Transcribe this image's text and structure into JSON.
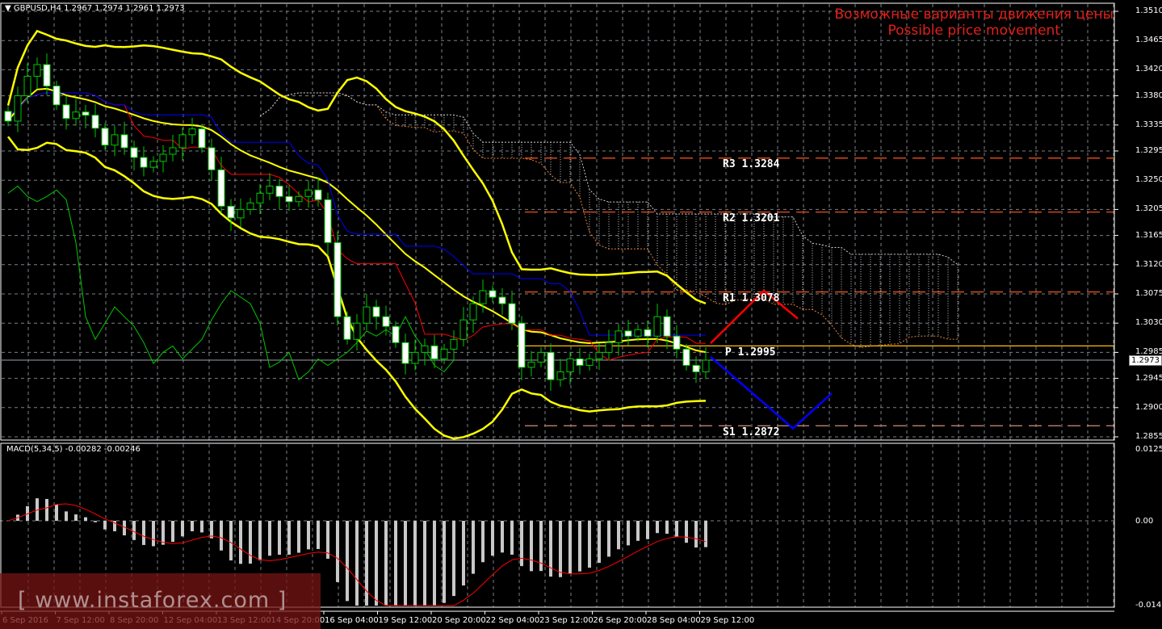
{
  "header": {
    "symbol_info": "GBPUSD,H4  1.2967 1.2974 1.2961 1.2973"
  },
  "title": {
    "line1": "Возможные варианты движения цены",
    "line2": "Possible price movement"
  },
  "macd": {
    "label": "MACD(5,34,5) -0.00282 -0.00246",
    "ticks": [
      "0.01259",
      "0.00",
      "-0.01478"
    ],
    "range": [
      -0.01478,
      0.01259
    ]
  },
  "watermark": {
    "text": "[ www.instaforex.com ]"
  },
  "current_price": "1.2973",
  "pivots": [
    {
      "label": "R3 1.3284",
      "value": 1.3284
    },
    {
      "label": "R2 1.3201",
      "value": 1.3201
    },
    {
      "label": "R1 1.3078",
      "value": 1.3078
    },
    {
      "label": "P 1.2995",
      "value": 1.2995
    },
    {
      "label": "S1 1.2872",
      "value": 1.2872
    }
  ],
  "colors": {
    "candle_up": "#00c800",
    "bollinger": "#ffff00",
    "tenkan": "#ff0000",
    "kijun": "#0000ff",
    "chikou": "#00c800",
    "pivot": "#e8501a",
    "bull_path": "#ff0000",
    "bear_path": "#0000ff"
  },
  "chart_data": {
    "type": "candlestick",
    "price_ticks": [
      "1.3510",
      "1.3465",
      "1.3420",
      "1.3380",
      "1.3335",
      "1.3295",
      "1.3250",
      "1.3205",
      "1.3165",
      "1.3120",
      "1.3075",
      "1.3030",
      "1.2985",
      "1.2945",
      "1.2900",
      "1.2855"
    ],
    "ylim": [
      1.2855,
      1.351
    ],
    "time_labels": [
      "6 Sep 2016",
      "7 Sep 12:00",
      "8 Sep 20:00",
      "12 Sep 04:00",
      "13 Sep 12:00",
      "14 Sep 20:00",
      "16 Sep 04:00",
      "19 Sep 12:00",
      "20 Sep 20:00",
      "22 Sep 04:00",
      "23 Sep 12:00",
      "26 Sep 20:00",
      "28 Sep 04:00",
      "29 Sep 12:00"
    ],
    "closes": [
      1.3341,
      1.338,
      1.341,
      1.3428,
      1.3395,
      1.3366,
      1.3345,
      1.3355,
      1.335,
      1.333,
      1.3304,
      1.332,
      1.33,
      1.3285,
      1.327,
      1.3279,
      1.329,
      1.33,
      1.332,
      1.3329,
      1.33,
      1.3266,
      1.321,
      1.3192,
      1.3205,
      1.3215,
      1.323,
      1.3241,
      1.3225,
      1.3217,
      1.3225,
      1.3235,
      1.322,
      1.3154,
      1.304,
      1.3005,
      1.303,
      1.3055,
      1.304,
      1.3025,
      1.3,
      1.2968,
      1.2985,
      1.2995,
      1.2975,
      1.299,
      1.3005,
      1.3035,
      1.306,
      1.308,
      1.307,
      1.306,
      1.303,
      1.2962,
      1.297,
      1.2985,
      1.2943,
      1.2955,
      1.2975,
      1.2965,
      1.2975,
      1.2985,
      1.3,
      1.3018,
      1.301,
      1.302,
      1.301,
      1.304,
      1.301,
      1.299,
      1.2965,
      1.2955,
      1.2973
    ],
    "projection_up": [
      [
        72.5,
        1.2999
      ],
      [
        78,
        1.308
      ],
      [
        81.5,
        1.3037
      ]
    ],
    "projection_down": [
      [
        72.5,
        1.2978
      ],
      [
        81,
        1.2868
      ],
      [
        85,
        1.2922
      ]
    ]
  }
}
